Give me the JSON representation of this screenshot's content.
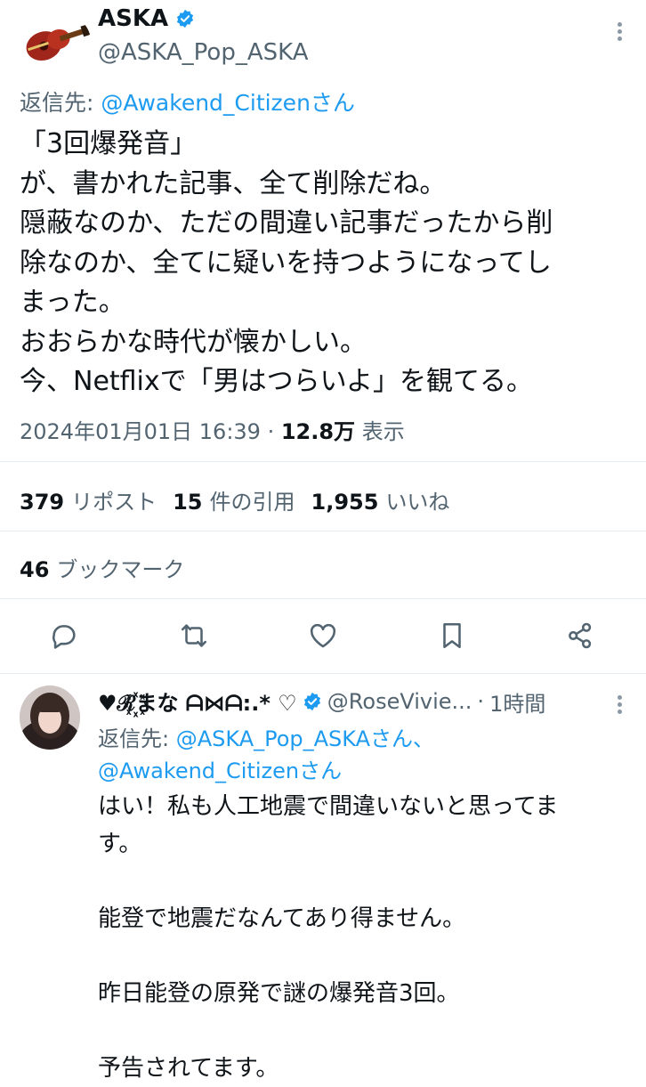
{
  "tweet": {
    "author_name": "ASKA",
    "author_handle": "@ASKA_Pop_ASKA",
    "reply_to_prefix": "返信先: ",
    "reply_to_handle": "@Awakend_Citizenさん",
    "text": "「3回爆発音」\nが、書かれた記事、全て削除だね。\n隠蔽なのか、ただの間違い記事だったから削\n除なのか、全てに疑いを持つようになってし\nまった。\nおおらかな時代が懐かしい。\n今、Netflixで「男はつらいよ」を観てる。",
    "timestamp": "2024年01月01日 16:39",
    "separator": " · ",
    "views_count": "12.8万",
    "views_label": "表示",
    "reposts_count": "379",
    "reposts_label": "リポスト",
    "quotes_count": "15",
    "quotes_label": "件の引用",
    "likes_count": "1,955",
    "likes_label": "いいね",
    "bookmarks_count": "46",
    "bookmarks_label": "ブックマーク",
    "icons": [
      "verified-badge-icon",
      "more-options-icon",
      "reply-icon",
      "retweet-icon",
      "like-icon",
      "bookmark-icon",
      "share-icon"
    ],
    "colors": {
      "verified": "#1d9bf0",
      "link": "#1d9bf0",
      "muted": "#536471"
    }
  },
  "reply": {
    "author_name": "♥ℛ꙰まな ᗩ⋈ᗩ:.* ♡",
    "author_handle": "@RoseVivie...",
    "separator": " · ",
    "time": "1時間",
    "reply_to_prefix": "返信先: ",
    "reply_to_handle_1": "@ASKA_Pop_ASKAさん、",
    "reply_to_handle_2": "@Awakend_Citizenさん",
    "text": "はい！私も人工地震で間違いないと思ってま\nす。\n\n能登で地震だなんてあり得ません。\n\n昨日能登の原発で謎の爆発音3回。\n\n予告されてます。"
  }
}
